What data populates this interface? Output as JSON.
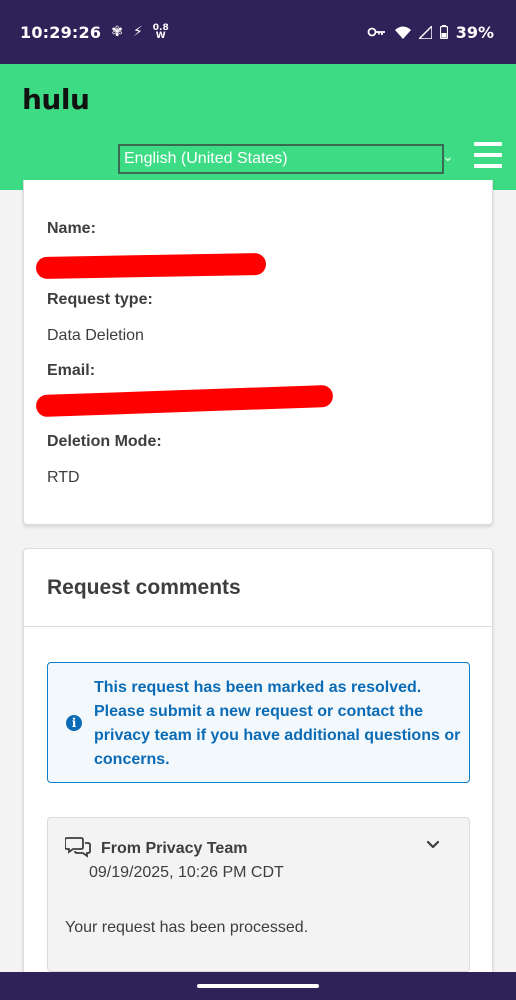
{
  "status_bar": {
    "time": "10:29:26",
    "network_speed_value": "0.8",
    "network_speed_unit": "W",
    "battery": "39%"
  },
  "header": {
    "logo": "hulu",
    "language": "English (United States)"
  },
  "details": {
    "name_label": "Name:",
    "request_type_label": "Request type:",
    "request_type_value": "Data Deletion",
    "email_label": "Email:",
    "deletion_mode_label": "Deletion Mode:",
    "deletion_mode_value": "RTD"
  },
  "comments": {
    "title": "Request comments",
    "alert": "This request has been marked as resolved. Please submit a new request or contact the privacy team if you have additional questions or concerns.",
    "items": [
      {
        "author": "From Privacy Team",
        "date": "09/19/2025, 10:26 PM CDT",
        "body": "Your request has been processed."
      }
    ]
  },
  "colors": {
    "status_bar": "#2f2258",
    "header_green": "#3ddc84",
    "alert_blue": "#0b6bb5",
    "redaction": "#ff0000"
  },
  "icons": [
    "flower-icon",
    "flash-icon",
    "key-icon",
    "wifi-icon",
    "signal-icon",
    "battery-icon",
    "menu-icon",
    "chevron-down-icon",
    "info-icon",
    "chat-bubbles-icon"
  ]
}
